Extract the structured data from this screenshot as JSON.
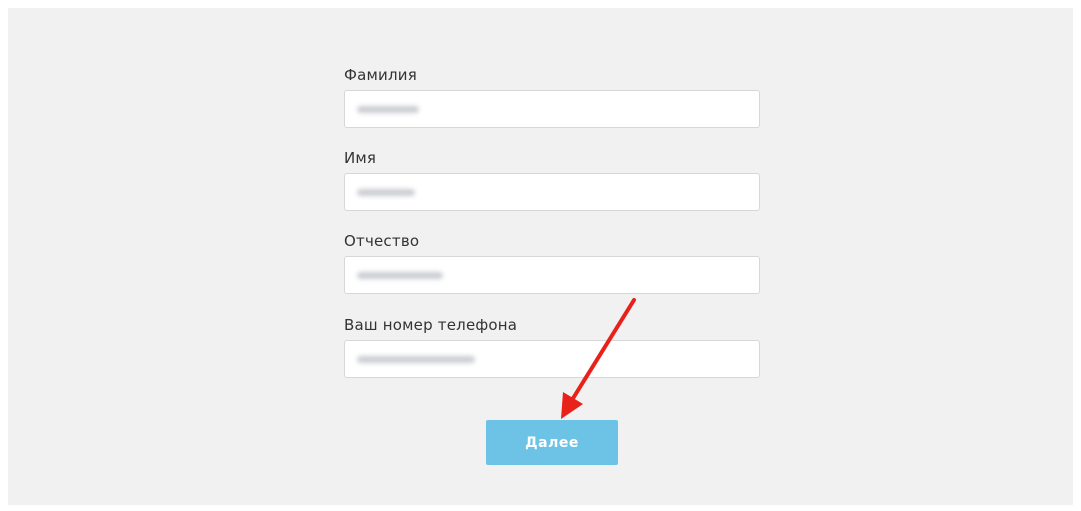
{
  "form": {
    "last_name": {
      "label": "Фамилия"
    },
    "first_name": {
      "label": "Имя"
    },
    "patronymic": {
      "label": "Отчество"
    },
    "phone": {
      "label": "Ваш номер телефона"
    },
    "next_button": "Далее"
  },
  "colors": {
    "panel_background": "#f1f1f1",
    "button_background": "#6cc3e6",
    "arrow": "#e8211a"
  },
  "annotation": {
    "icon": "red-arrow-icon"
  }
}
